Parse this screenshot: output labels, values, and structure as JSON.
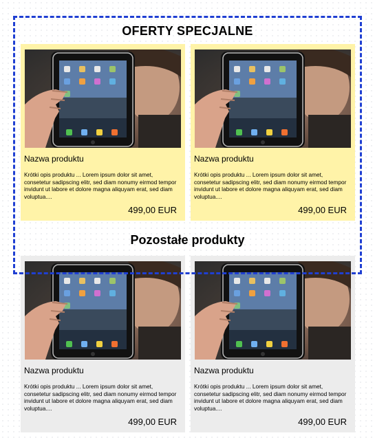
{
  "sections": {
    "special_title": "OFERTY SPECJALNE",
    "other_title": "Pozostałe produkty"
  },
  "products": [
    {
      "name": "Nazwa produktu",
      "description": "Krótki opis produktu ... Lorem ipsum dolor sit amet, consetetur sadipscing elitr, sed diam nonumy eirmod tempor invidunt ut labore et dolore magna aliquyam erat, sed diam voluptua....",
      "price": "499,00 EUR"
    },
    {
      "name": "Nazwa produktu",
      "description": "Krótki opis produktu ... Lorem ipsum dolor sit amet, consetetur sadipscing elitr, sed diam nonumy eirmod tempor invidunt ut labore et dolore magna aliquyam erat, sed diam voluptua....",
      "price": "499,00 EUR"
    },
    {
      "name": "Nazwa produktu",
      "description": "Krótki opis produktu ... Lorem ipsum dolor sit amet, consetetur sadipscing elitr, sed diam nonumy eirmod tempor invidunt ut labore et dolore magna aliquyam erat, sed diam voluptua....",
      "price": "499,00 EUR"
    },
    {
      "name": "Nazwa produktu",
      "description": "Krótki opis produktu ... Lorem ipsum dolor sit amet, consetetur sadipscing elitr, sed diam nonumy eirmod tempor invidunt ut labore et dolore magna aliquyam erat, sed diam voluptua....",
      "price": "499,00 EUR"
    }
  ],
  "colors": {
    "special_card_bg": "#fff3a8",
    "regular_card_bg": "#ececec",
    "dashed_border": "#1f3fd2"
  },
  "image_icon": "tablet-photo-icon"
}
